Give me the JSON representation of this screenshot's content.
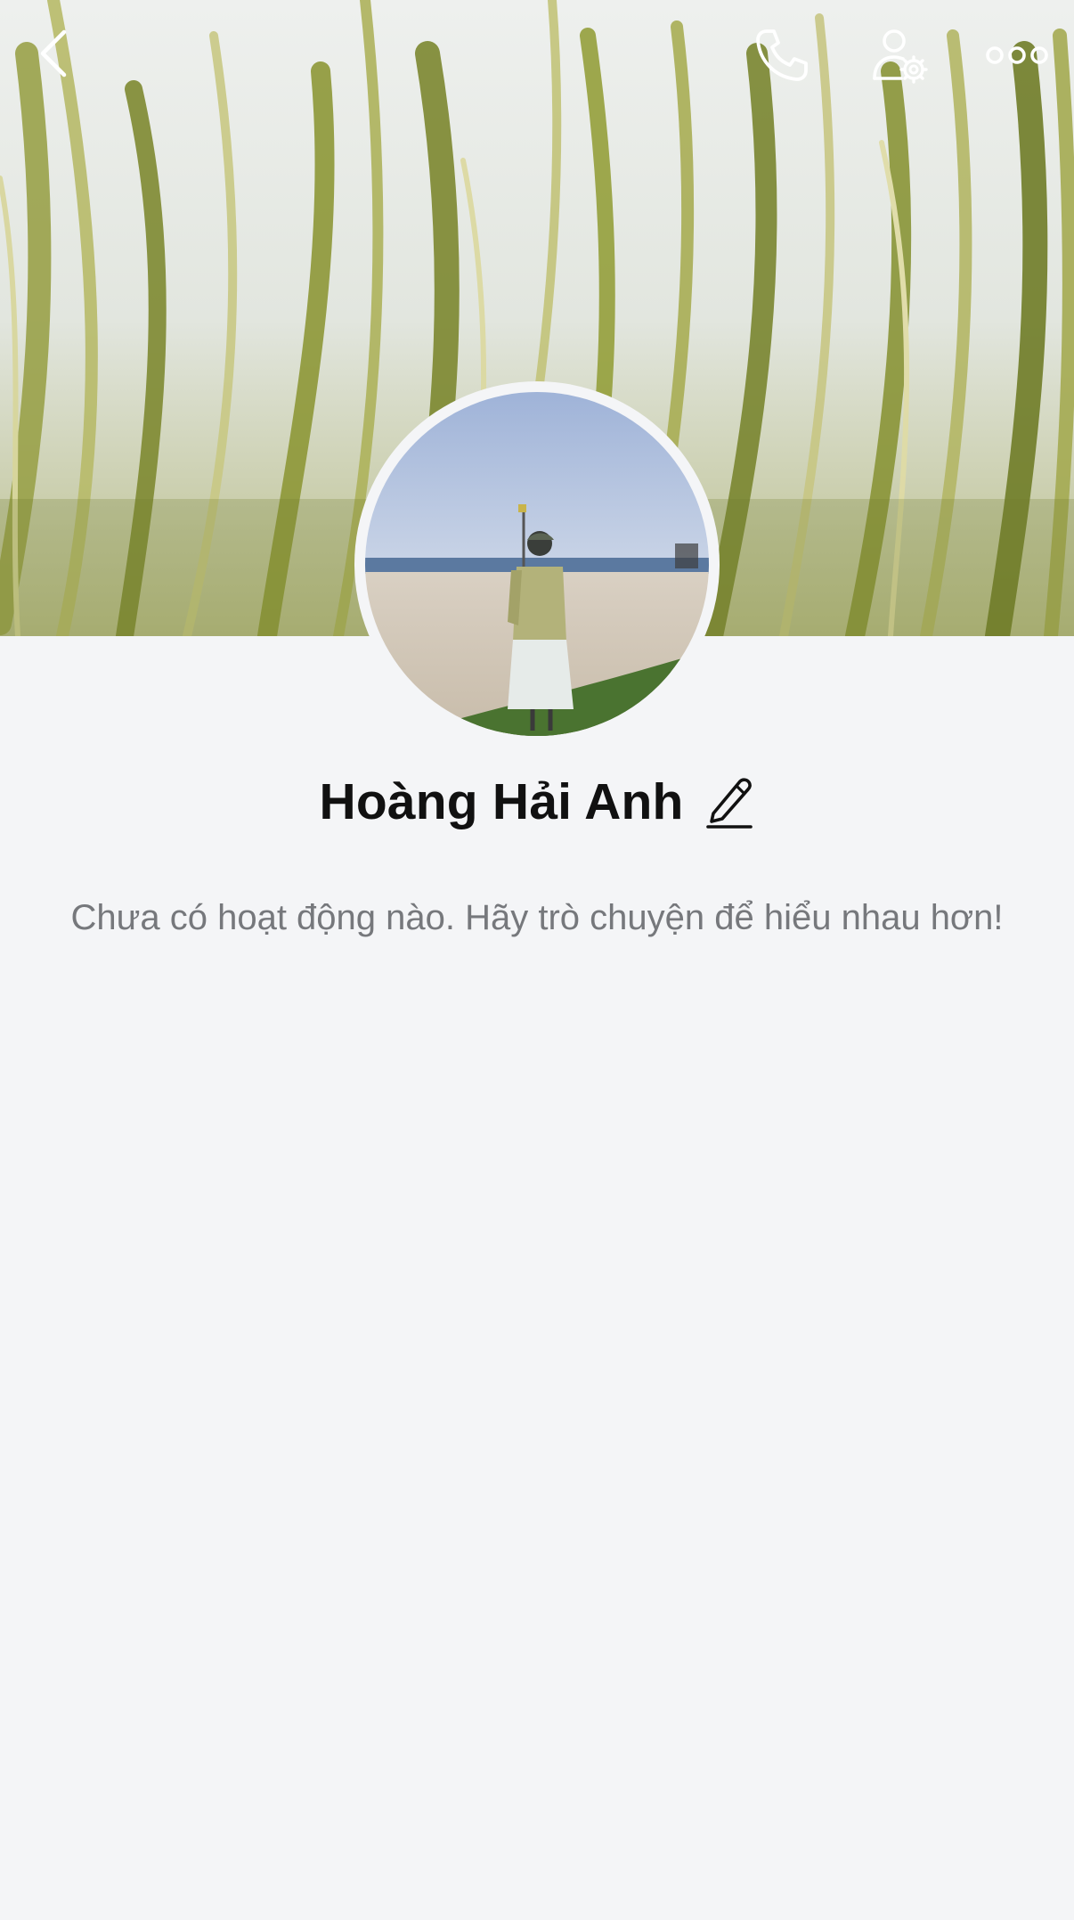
{
  "header": {
    "back_icon": "chevron-left-icon",
    "call_icon": "phone-icon",
    "user_settings_icon": "user-gear-icon",
    "more_icon": "more-dots-icon"
  },
  "profile": {
    "name": "Hoàng Hải Anh",
    "edit_icon": "pencil-icon"
  },
  "feed": {
    "empty_message": "Chưa có hoạt động nào. Hãy trò chuyện để hiểu nhau hơn!"
  },
  "colors": {
    "background": "#f4f5f7",
    "name_text": "#111111",
    "secondary_text": "#76787c",
    "icon_on_cover": "#ffffff"
  }
}
